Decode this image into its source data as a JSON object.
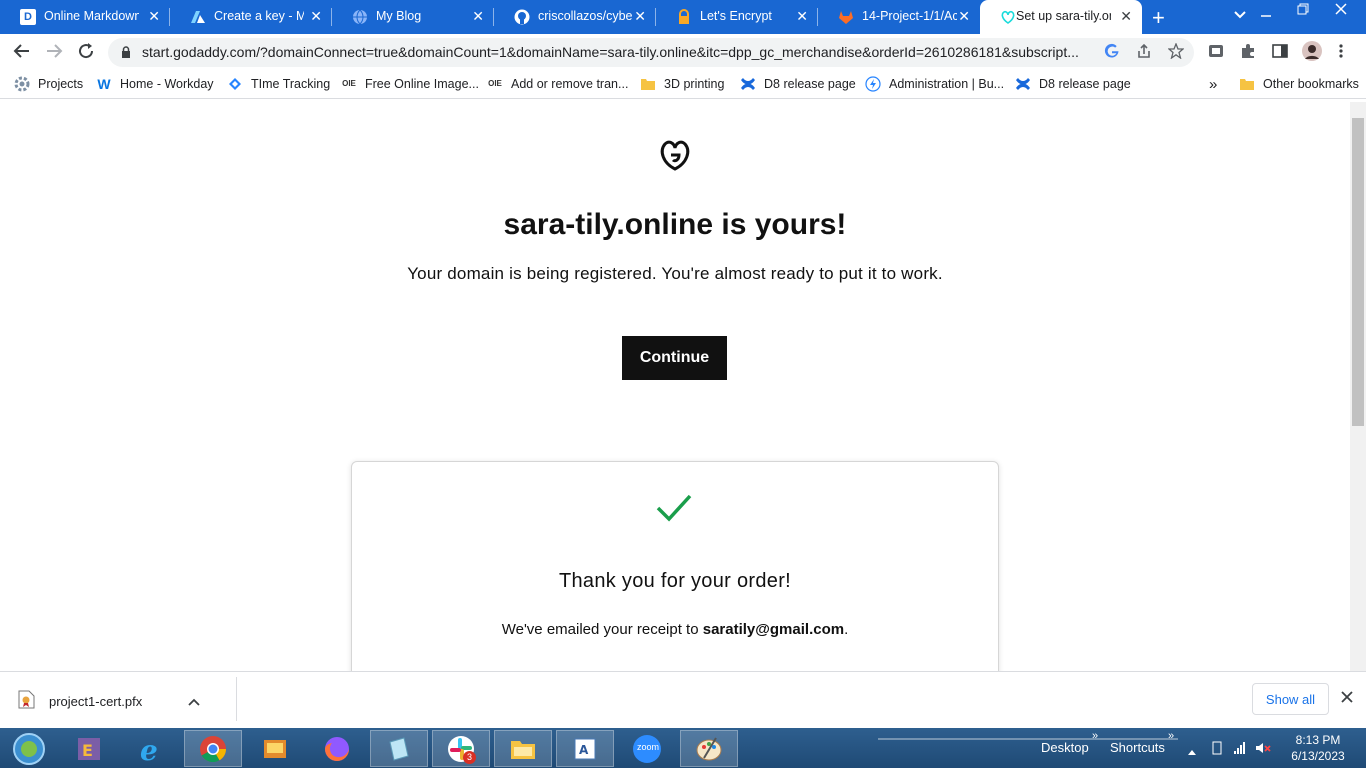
{
  "tabs": [
    {
      "label": "Online Markdown",
      "icon": "D"
    },
    {
      "label": "Create a key - Mic",
      "icon": "A"
    },
    {
      "label": "My Blog",
      "icon": "globe"
    },
    {
      "label": "criscollazos/cybers",
      "icon": "github"
    },
    {
      "label": "Let's Encrypt",
      "icon": "lock"
    },
    {
      "label": "14-Project-1/1/Ac",
      "icon": "gitlab"
    },
    {
      "label": "Set up sara-tily.on",
      "icon": "godaddy"
    }
  ],
  "tab_close_glyph": "✕",
  "new_tab_glyph": "+",
  "url": "start.godaddy.com/?domainConnect=true&domainCount=1&domainName=sara-tily.online&itc=dpp_gc_merchandise&orderId=2610286181&subscript...",
  "bookmarks": [
    "Projects",
    "Home - Workday",
    "TIme Tracking",
    "Free Online Image...",
    "Add or remove tran...",
    "3D printing",
    "D8 release page",
    "Administration | Bu...",
    "D8 release page"
  ],
  "other_bookmarks": "Other bookmarks",
  "overflow_glyph": "»",
  "page": {
    "headline": "sara-tily.online is yours!",
    "subline": "Your domain is being registered. You're almost ready to put it to work.",
    "continue_label": "Continue",
    "thanks": "Thank you for your order!",
    "receipt_prefix": "We've emailed your receipt to ",
    "receipt_email": "saratily@gmail.com",
    "receipt_suffix": "."
  },
  "colors": {
    "tabstrip": "#1967d2",
    "check": "#1a9e4b",
    "button": "#111111"
  },
  "download": {
    "filename": "project1-cert.pfx",
    "show_all": "Show all"
  },
  "taskbar": {
    "desktop": "Desktop",
    "shortcuts": "Shortcuts",
    "time": "8:13 PM",
    "date": "6/13/2023",
    "slack_badge": "3",
    "zoom_label": "zoom"
  }
}
